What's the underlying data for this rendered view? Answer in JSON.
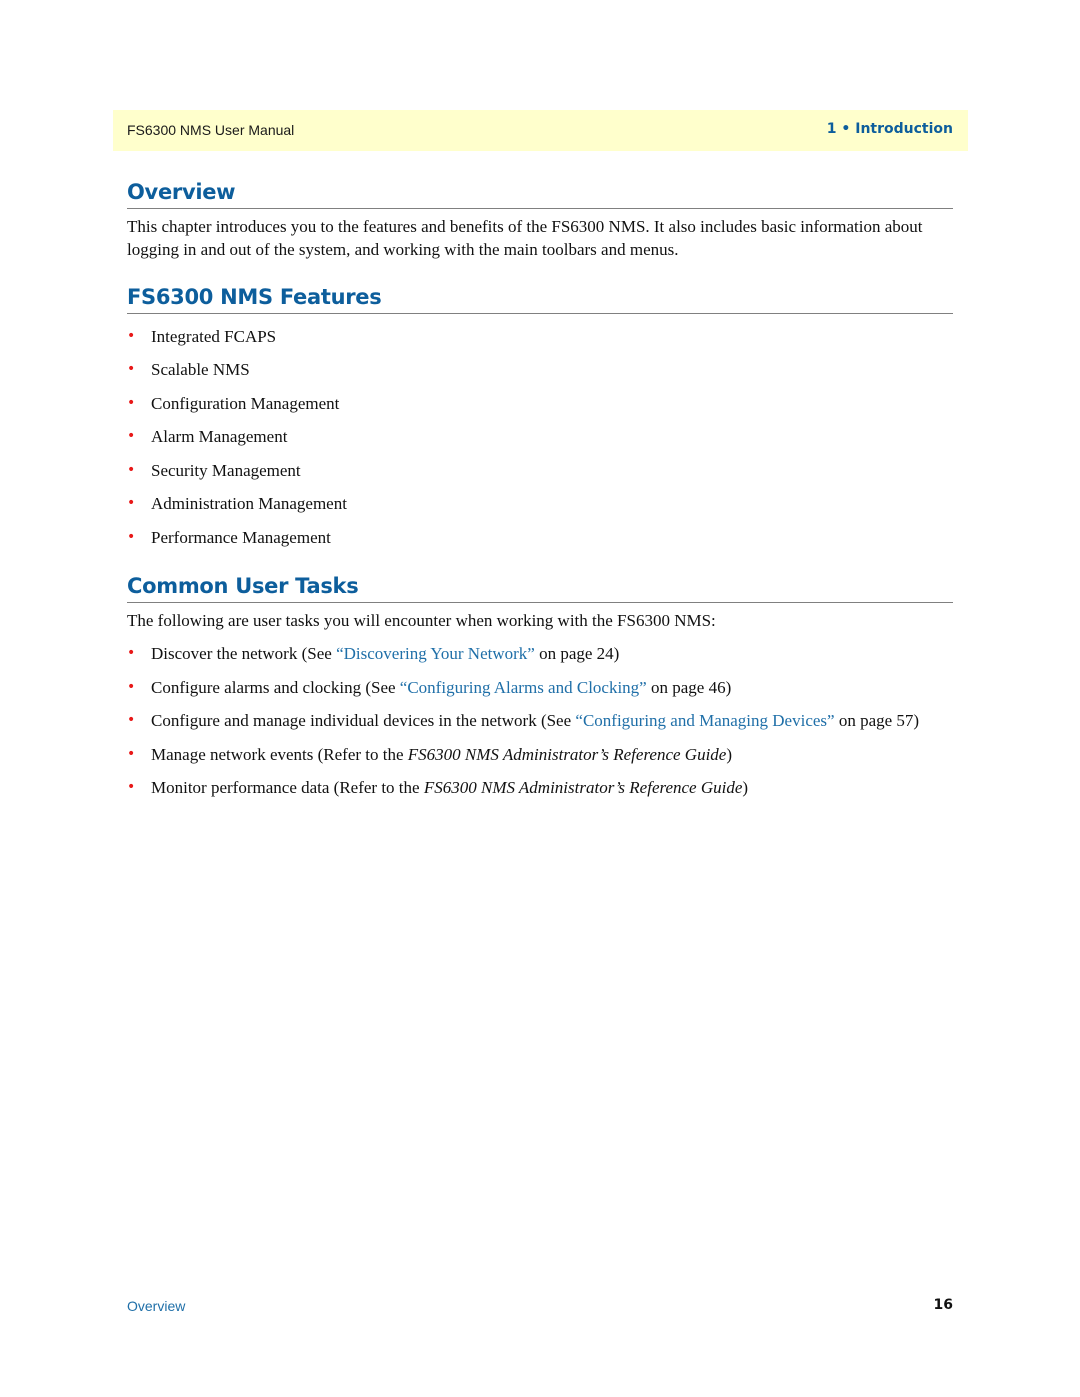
{
  "header": {
    "manual_title": "FS6300 NMS User Manual",
    "chapter": "1 • Introduction"
  },
  "sections": {
    "overview": {
      "heading": "Overview",
      "body": "This chapter introduces you to the features and benefits of the FS6300 NMS. It also includes basic information about logging in and out of the system, and working with the main toolbars and menus."
    },
    "features": {
      "heading": "FS6300 NMS Features",
      "items": [
        "Integrated FCAPS",
        "Scalable NMS",
        "Configuration Management",
        "Alarm Management",
        "Security Management",
        "Administration Management",
        "Performance Management"
      ]
    },
    "tasks": {
      "heading": "Common User Tasks",
      "intro": "The following are user tasks you will encounter when working with the FS6300 NMS:",
      "items": [
        {
          "before": "Discover the network (See ",
          "link": "“Discovering Your Network”",
          "after": " on page 24)"
        },
        {
          "before": "Configure alarms and clocking (See ",
          "link": "“Configuring Alarms and Clocking”",
          "after": " on page 46)"
        },
        {
          "before": "Configure and manage individual devices in the network (See ",
          "link": "“Configuring and Managing Devices”",
          "after": " on page 57)"
        },
        {
          "before": "Manage network events (Refer to the ",
          "italic": "FS6300 NMS Administrator’s Reference Guide",
          "after": ")"
        },
        {
          "before": "Monitor performance data (Refer to the ",
          "italic": "FS6300 NMS Administrator’s Reference Guide",
          "after": ")"
        }
      ]
    }
  },
  "footer": {
    "section_link": "Overview",
    "page_number": "16"
  },
  "bullet_glyph": "•",
  "colors": {
    "heading": "#0d5e9c",
    "link": "#1f6fa8",
    "bullet": "#e81818",
    "header_bg": "#ffffcc"
  }
}
